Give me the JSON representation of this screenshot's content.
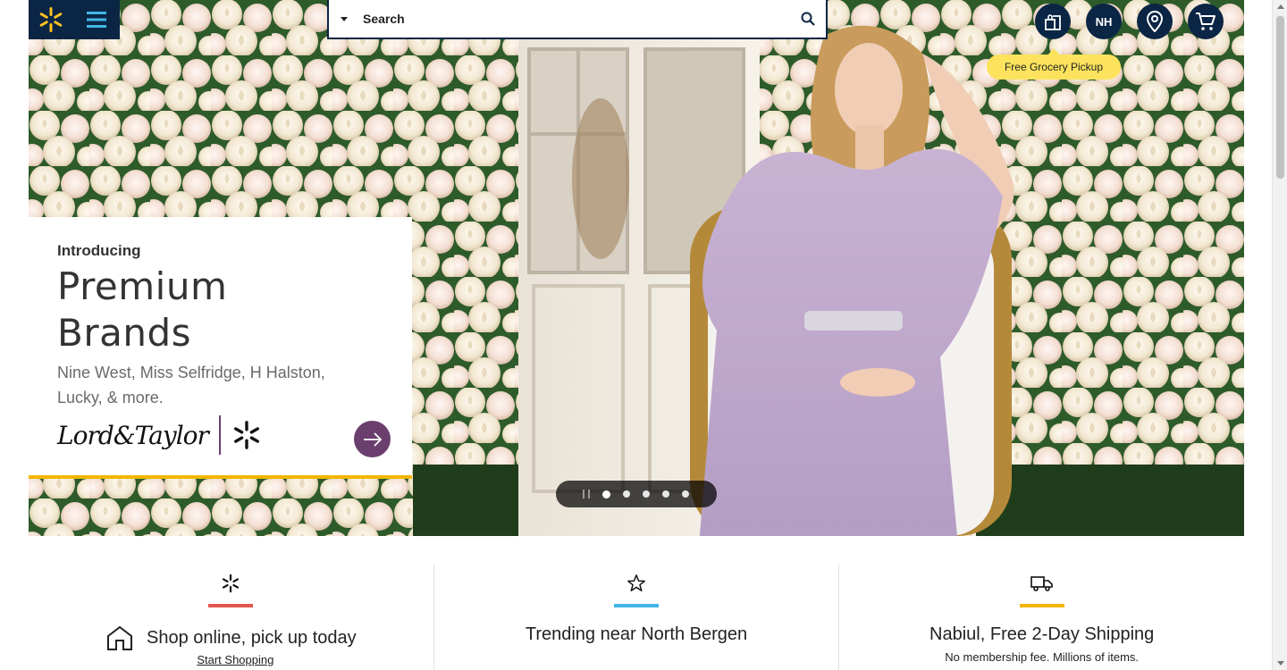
{
  "header": {
    "logo_icon": "spark-icon",
    "menu_icon": "hamburger-menu-icon",
    "search": {
      "placeholder": "Search",
      "dept_icon": "caret-down-icon",
      "button_icon": "magnifier-icon"
    },
    "icons": {
      "services": "grocery-bag-icon",
      "account_initials": "NH",
      "store": "location-pin-icon",
      "cart": "cart-icon"
    },
    "pickup_tooltip": "Free Grocery Pickup"
  },
  "hero": {
    "intro": "Introducing",
    "headline_line1": "Premium",
    "headline_line2": "Brands",
    "subtitle": "Nine West, Miss Selfridge, H Halston, Lucky, & more.",
    "brand_logo": "Lord&Taylor",
    "cta_icon": "arrow-right-icon"
  },
  "carousel": {
    "slides": 5,
    "active": 1,
    "pause_icon": "pause-icon"
  },
  "value_props": [
    {
      "icon": "spark-icon",
      "accent": "#e2564f",
      "title": "Shop online, pick up today",
      "link": "Start Shopping",
      "side_icon": "store-house-icon"
    },
    {
      "icon": "star-icon",
      "accent": "#41b6e6",
      "title": "Trending near North Bergen"
    },
    {
      "icon": "truck-icon",
      "accent": "#f2b600",
      "title": "Nabiul, Free 2-Day Shipping",
      "text": "No membership fee. Millions of items."
    }
  ],
  "colors": {
    "navy": "#0b2545",
    "spark": "#ffc220",
    "pill": "#fde35d",
    "purple": "#6a3f6e",
    "gold": "#f2b600"
  }
}
